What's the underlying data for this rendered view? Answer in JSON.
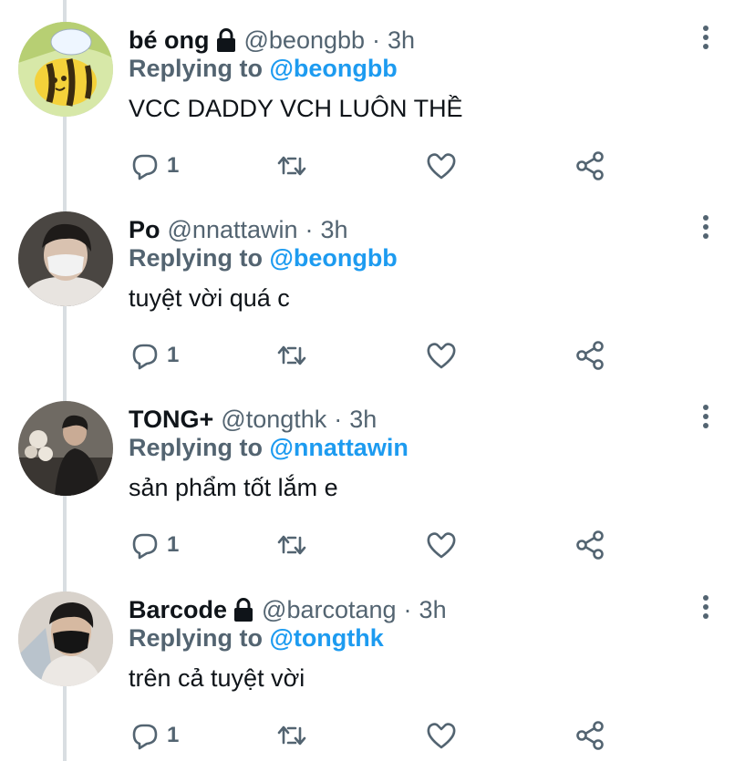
{
  "tweets": [
    {
      "name": "bé ong",
      "locked": true,
      "handle": "@beongbb",
      "separator": "·",
      "time": "3h",
      "replying_prefix": "Replying to ",
      "replying_to": "@beongbb",
      "text": "VCC DADDY VCH LUÔN THỀ",
      "reply_count": "1",
      "avatar_icon": "bee-avatar"
    },
    {
      "name": "Po",
      "locked": false,
      "handle": "@nnattawin",
      "separator": "·",
      "time": "3h",
      "replying_prefix": "Replying to ",
      "replying_to": "@beongbb",
      "text": "tuyệt vời quá c",
      "reply_count": "1",
      "avatar_icon": "person-mask-avatar"
    },
    {
      "name": "TONG+",
      "locked": false,
      "handle": "@tongthk",
      "separator": "·",
      "time": "3h",
      "replying_prefix": "Replying to ",
      "replying_to": "@nnattawin",
      "text": "sản phẩm tốt lắm e",
      "reply_count": "1",
      "avatar_icon": "person-flowers-avatar"
    },
    {
      "name": "Barcode",
      "locked": true,
      "handle": "@barcotang",
      "separator": "·",
      "time": "3h",
      "replying_prefix": "Replying to ",
      "replying_to": "@tongthk",
      "text": "trên cả tuyệt vời",
      "reply_count": "1",
      "avatar_icon": "person-black-mask-avatar"
    }
  ],
  "colors": {
    "text_primary": "#0f1419",
    "text_secondary": "#536471",
    "accent": "#1d9bf0",
    "thread_line": "#d9dee2"
  }
}
